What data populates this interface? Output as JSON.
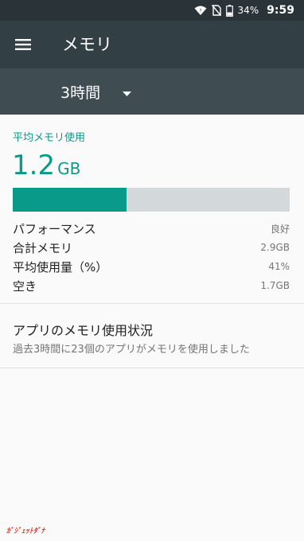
{
  "status_bar": {
    "battery_percent": "34%",
    "time": "9:59",
    "icons": [
      "wifi-icon",
      "no-sim-icon",
      "battery-icon"
    ]
  },
  "app_bar": {
    "menu_icon": "menu-icon",
    "title": "メモリ"
  },
  "time_range": {
    "selected": "3時間",
    "icon": "dropdown-arrow-icon"
  },
  "memory": {
    "avg_label": "平均メモリ使用",
    "avg_number": "1.2",
    "avg_unit": "GB",
    "usage_fraction": 0.41,
    "stats": [
      {
        "label": "パフォーマンス",
        "value": "良好"
      },
      {
        "label": "合計メモリ",
        "value": "2.9GB"
      },
      {
        "label": "平均使用量（%）",
        "value": "41%"
      },
      {
        "label": "空き",
        "value": "1.7GB"
      }
    ]
  },
  "apps_memory": {
    "title": "アプリのメモリ使用状況",
    "subtitle": "過去3時間に23個のアプリがメモリを使用しました"
  },
  "colors": {
    "accent": "#0a9a8a",
    "status_bar": "#2a3438",
    "app_bar": "#323f44",
    "sub_bar": "#3f4d53",
    "bar_track": "#d3d8db"
  }
}
